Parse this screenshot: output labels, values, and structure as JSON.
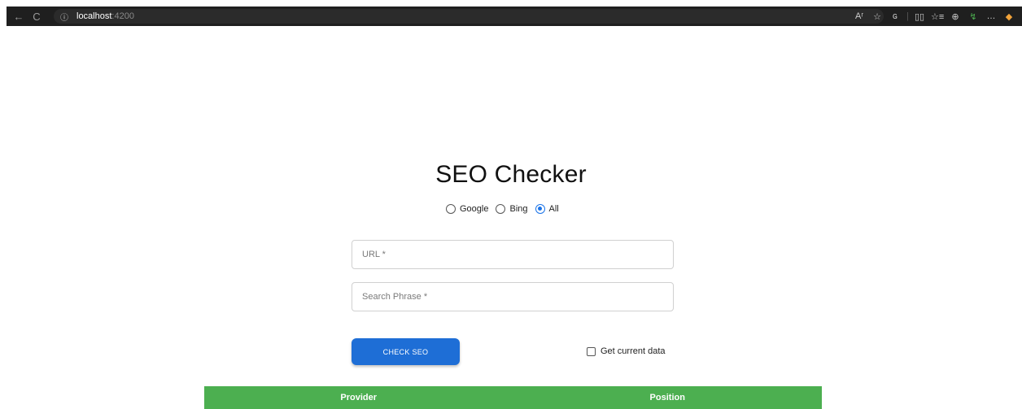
{
  "browser": {
    "address_host": "localhost",
    "address_port": ":4200",
    "back_icon": "←",
    "refresh_icon": "C",
    "info_icon": "ⓘ",
    "tools": [
      "Aʳ",
      "☆",
      "ɢ",
      "|",
      "▯▯",
      "☆≡",
      "⊕",
      "↯",
      "…",
      "◆"
    ]
  },
  "page": {
    "title": "SEO Checker",
    "radios": [
      {
        "label": "Google",
        "checked": false
      },
      {
        "label": "Bing",
        "checked": false
      },
      {
        "label": "All",
        "checked": true
      }
    ],
    "url_placeholder": "URL *",
    "phrase_placeholder": "Search Phrase *",
    "check_button": "CHECK SEO",
    "checkbox_label": "Get current data",
    "table_headers": [
      "Provider",
      "Position"
    ]
  },
  "colors": {
    "accent": "#1e6ed6",
    "table_header": "#4caf50"
  }
}
